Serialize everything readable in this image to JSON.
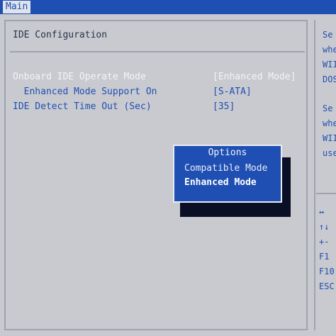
{
  "menu": {
    "active_tab": "Main"
  },
  "config": {
    "title": "IDE Configuration",
    "rows": [
      {
        "label": "Onboard IDE Operate Mode",
        "value": "[Enhanced Mode]"
      },
      {
        "label": "  Enhanced Mode Support On",
        "value": "[S-ATA]"
      },
      {
        "label": "IDE Detect Time Out (Sec)",
        "value": "[35]"
      }
    ]
  },
  "popup": {
    "title": "Options",
    "options": [
      "Compatible Mode",
      "Enhanced Mode"
    ],
    "selected": "Enhanced Mode"
  },
  "help": {
    "lines": [
      "Se",
      "whe",
      "WII",
      "DOS",
      "Se",
      "whe",
      "WII",
      "use"
    ],
    "keys": [
      "↔",
      "↑↓",
      "+-",
      "F1",
      "F10",
      "ESC"
    ]
  },
  "colors": {
    "bios_blue": "#1f4fb3",
    "background": "#c9cacf",
    "highlight_text": "#f3f4f8"
  }
}
